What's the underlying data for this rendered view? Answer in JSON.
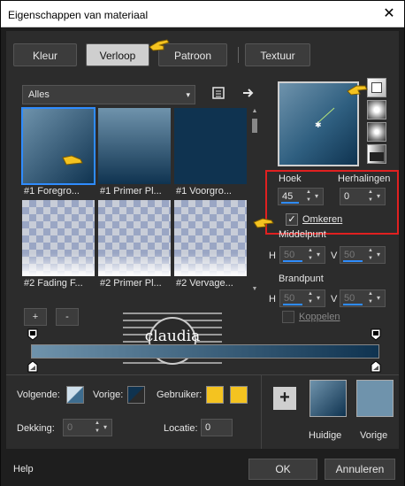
{
  "window": {
    "title": "Eigenschappen van materiaal",
    "close": "✕"
  },
  "tabs": [
    {
      "label": "Kleur"
    },
    {
      "label": "Verloop",
      "active": true
    },
    {
      "label": "Patroon"
    },
    {
      "label": "Textuur"
    }
  ],
  "filter": {
    "value": "Alles",
    "arrow": "▾"
  },
  "toolbar_icons": [
    "list-icon",
    "arrow-right-icon"
  ],
  "gradients": [
    {
      "label": "#1 Foregro...",
      "selected": true,
      "style": "fg"
    },
    {
      "label": "#1 Primer Pl...",
      "style": "primer"
    },
    {
      "label": "#1 Voorgro...",
      "style": "dark"
    },
    {
      "label": "#2 Fading F...",
      "style": "fade-white"
    },
    {
      "label": "#2 Primer Pl...",
      "style": "fade-white"
    },
    {
      "label": "#2 Vervage...",
      "style": "fade-white"
    }
  ],
  "list_buttons": {
    "add": "+",
    "remove": "-"
  },
  "watermark": {
    "brand": "claudia"
  },
  "angle": {
    "label": "Hoek",
    "value": "45"
  },
  "repeats": {
    "label": "Herhalingen",
    "value": "0"
  },
  "invert": {
    "label": "Omkeren",
    "checked": true
  },
  "midpoint": {
    "label": "Middelpunt",
    "h_label": "H",
    "h_value": "50",
    "v_label": "V",
    "v_value": "50"
  },
  "focal": {
    "label": "Brandpunt",
    "h_label": "H",
    "h_value": "50",
    "v_label": "V",
    "v_value": "50",
    "link_label": "Koppelen",
    "link_checked": false
  },
  "stops": {
    "next_label": "Volgende:",
    "prev_label": "Vorige:",
    "user_label": "Gebruiker:",
    "opacity_label": "Dekking:",
    "opacity_value": "0",
    "location_label": "Locatie:",
    "location_value": "0"
  },
  "previews": {
    "current_label": "Huidige",
    "previous_label": "Vorige"
  },
  "footer": {
    "help": "Help",
    "ok": "OK",
    "cancel": "Annuleren"
  },
  "colors": {
    "gradient_dark": "#0f3350",
    "gradient_light": "#6f93ac",
    "highlight": "#2f8cff",
    "red_frame": "#e02020",
    "user_color": "#f4c320"
  }
}
